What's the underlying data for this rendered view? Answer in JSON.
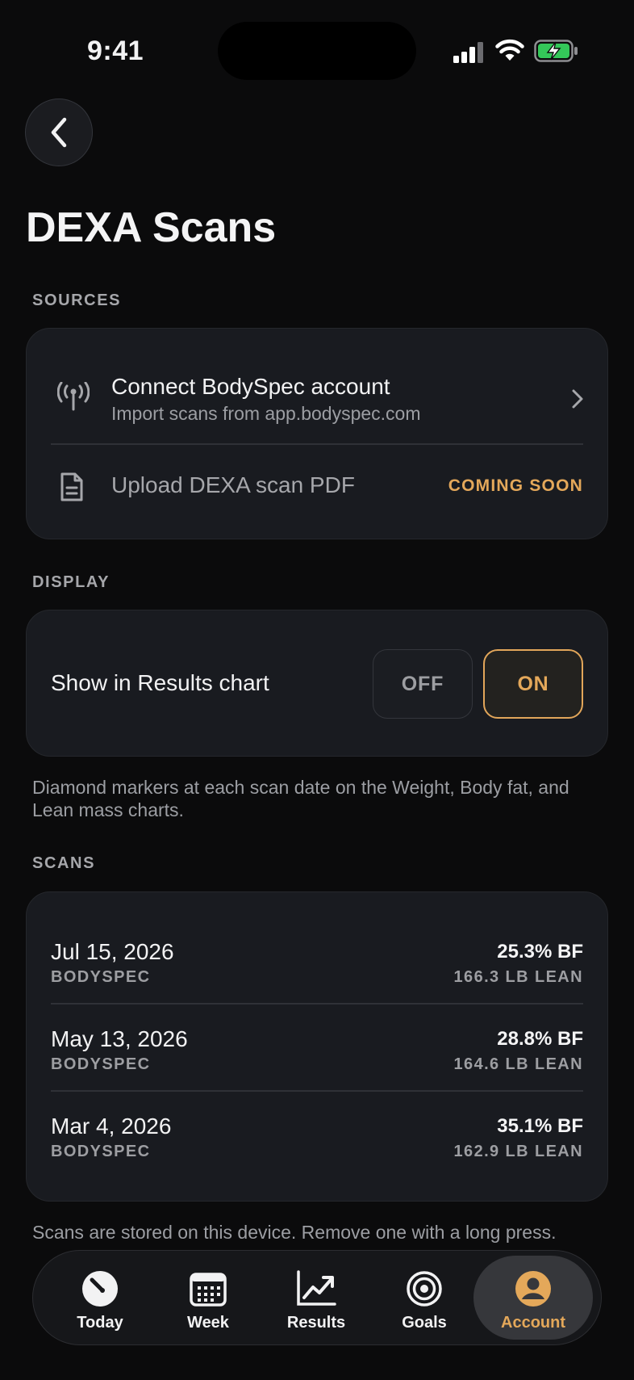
{
  "status": {
    "time": "9:41"
  },
  "page": {
    "title": "DEXA Scans"
  },
  "sections": {
    "sources": "SOURCES",
    "display": "DISPLAY",
    "scans": "SCANS"
  },
  "sources": {
    "connect": {
      "title": "Connect BodySpec account",
      "subtitle": "Import scans from app.bodyspec.com"
    },
    "upload": {
      "title": "Upload DEXA scan PDF",
      "badge": "COMING SOON"
    }
  },
  "display": {
    "label": "Show in Results chart",
    "off_label": "OFF",
    "on_label": "ON",
    "selected": "ON",
    "helper": "Diamond markers at each scan date on the Weight, Body fat, and Lean mass charts."
  },
  "scans": [
    {
      "date": "Jul 15, 2026",
      "source": "BODYSPEC",
      "bf": "25.3% BF",
      "lean": "166.3 LB LEAN"
    },
    {
      "date": "May 13, 2026",
      "source": "BODYSPEC",
      "bf": "28.8% BF",
      "lean": "164.6 LB LEAN"
    },
    {
      "date": "Mar 4, 2026",
      "source": "BODYSPEC",
      "bf": "35.1% BF",
      "lean": "162.9 LB LEAN"
    }
  ],
  "scans_footer": "Scans are stored on this device. Remove one with a long press.",
  "tabs": [
    {
      "label": "Today",
      "icon": "gauge-icon"
    },
    {
      "label": "Week",
      "icon": "calendar-icon"
    },
    {
      "label": "Results",
      "icon": "trend-chart-icon"
    },
    {
      "label": "Goals",
      "icon": "target-icon"
    },
    {
      "label": "Account",
      "icon": "person-icon",
      "active": true
    }
  ],
  "colors": {
    "accent": "#e4a85a",
    "background": "#0b0b0c",
    "card": "#191b20",
    "battery": "#34c759"
  }
}
